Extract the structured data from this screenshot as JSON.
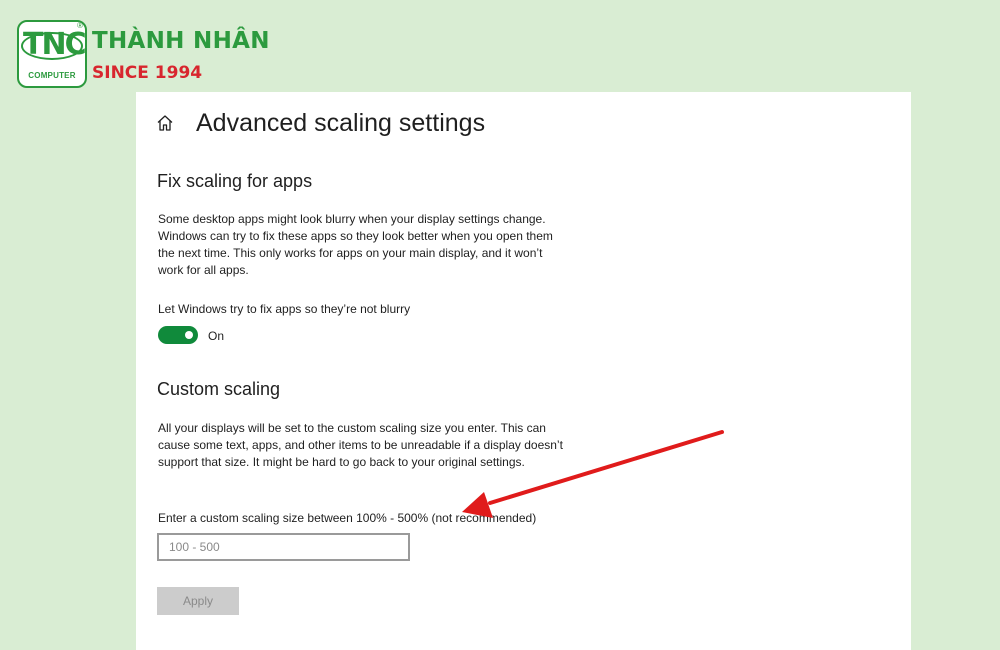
{
  "brand": {
    "logo_text": "TNC",
    "logo_subtitle": "COMPUTER",
    "name": "THÀNH NHÂN",
    "since": "SINCE 1994",
    "primary_color": "#2c9a3e",
    "accent_color": "#d8262e"
  },
  "page": {
    "title": "Advanced scaling settings",
    "home_icon": "home-icon"
  },
  "fix_scaling": {
    "heading": "Fix scaling for apps",
    "description": "Some desktop apps might look blurry when your display settings change. Windows can try to fix these apps so they look better when you open them the next time. This only works for apps on your main display, and it won’t work for all apps.",
    "toggle_label": "Let Windows try to fix apps so they’re not blurry",
    "toggle_state": "On",
    "toggle_on": true,
    "toggle_color": "#108a3b"
  },
  "custom_scaling": {
    "heading": "Custom scaling",
    "description": "All your displays will be set to the custom scaling size you enter. This can cause some text, apps, and other items to be unreadable if a display doesn’t support that size. It might be hard to go back to your original settings.",
    "input_label": "Enter a custom scaling size between 100% - 500% (not recommended)",
    "input_value": "",
    "input_placeholder": "100 - 500",
    "apply_label": "Apply"
  },
  "annotation": {
    "arrow_color": "#e01b1b"
  }
}
